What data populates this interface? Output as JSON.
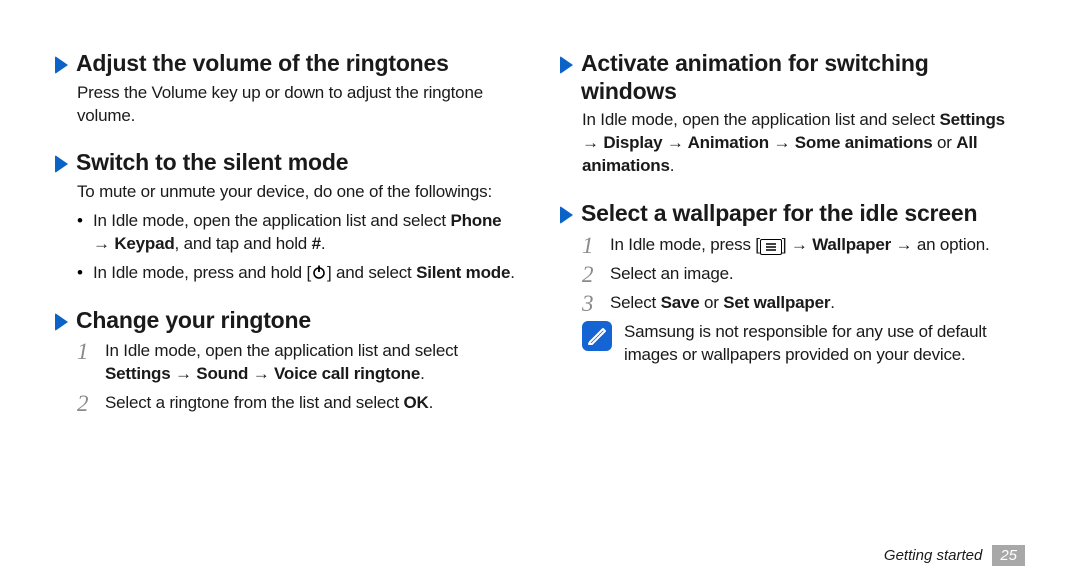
{
  "left": {
    "sec1": {
      "title": "Adjust the volume of the ringtones",
      "text": "Press the Volume key up or down to adjust the ringtone volume."
    },
    "sec2": {
      "title": "Switch to the silent mode",
      "intro": "To mute or unmute your device, do one of the followings:",
      "b1_pre": "In Idle mode, open the application list and select ",
      "b1_bold1": "Phone → Keypad",
      "b1_mid": ", and tap and hold ",
      "b1_bold2": "#",
      "b1_post": ".",
      "b2_pre": "In Idle mode, press and hold [",
      "b2_mid": "] and select ",
      "b2_bold": "Silent mode",
      "b2_post": "."
    },
    "sec3": {
      "title": "Change your ringtone",
      "step1_pre": "In Idle mode, open the application list and select ",
      "step1_bold": "Settings → Sound → Voice call ringtone",
      "step1_post": ".",
      "step2_pre": "Select a ringtone from the list and select ",
      "step2_bold": "OK",
      "step2_post": ".",
      "n1": "1",
      "n2": "2"
    }
  },
  "right": {
    "sec1": {
      "title": "Activate animation for switching windows",
      "p_pre": "In Idle mode, open the application list and select ",
      "p_bold1": "Settings → Display → Animation → Some animations",
      "p_mid": " or ",
      "p_bold2": "All animations",
      "p_post": "."
    },
    "sec2": {
      "title": "Select a wallpaper for the idle screen",
      "n1": "1",
      "n2": "2",
      "n3": "3",
      "s1_pre": "In Idle mode, press [",
      "s1_mid1": "] → ",
      "s1_bold": "Wallpaper",
      "s1_mid2": " → an option.",
      "s2": "Select an image.",
      "s3_pre": "Select ",
      "s3_bold1": "Save",
      "s3_mid": " or ",
      "s3_bold2": "Set wallpaper",
      "s3_post": ".",
      "note": "Samsung is not responsible for any use of default images or wallpapers provided on your device."
    }
  },
  "footer": {
    "label": "Getting started",
    "page": "25"
  }
}
